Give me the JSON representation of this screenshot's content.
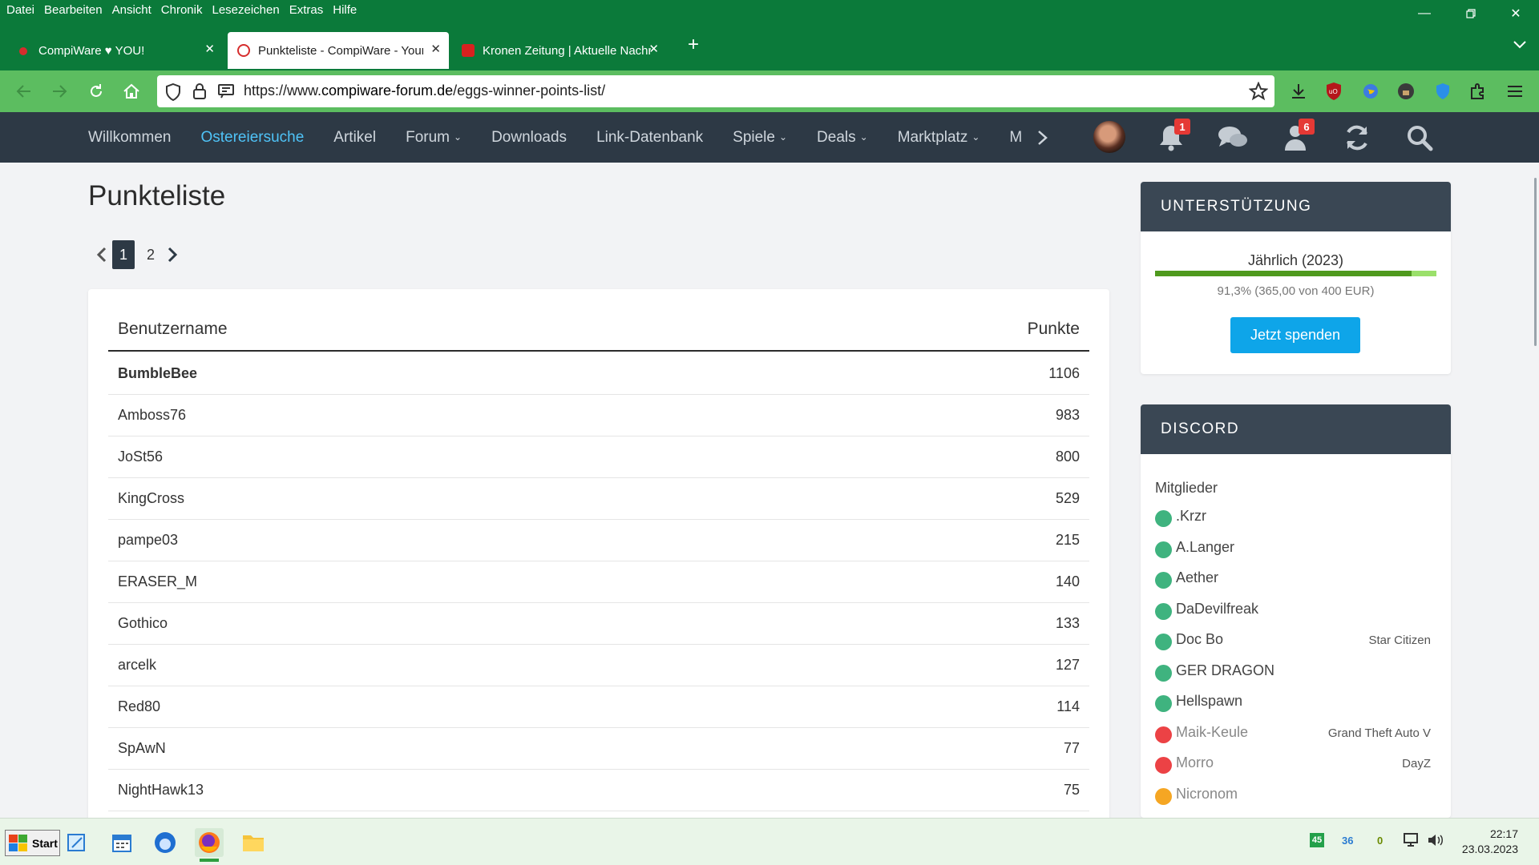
{
  "browser": {
    "menu": [
      "Datei",
      "Bearbeiten",
      "Ansicht",
      "Chronik",
      "Lesezeichen",
      "Extras",
      "Hilfe"
    ],
    "tabs": [
      {
        "title": "CompiWare ♥ YOU!",
        "active": false
      },
      {
        "title": "Punkteliste - CompiWare - Your",
        "active": true
      },
      {
        "title": "Kronen Zeitung | Aktuelle Nachr",
        "active": false
      }
    ],
    "url_prefix": "https://www.",
    "url_domain": "compiware-forum.de",
    "url_path": "/eggs-winner-points-list/"
  },
  "site": {
    "nav": [
      {
        "label": "Willkommen",
        "active": false,
        "dropdown": false
      },
      {
        "label": "Ostereiersuche",
        "active": true,
        "dropdown": false
      },
      {
        "label": "Artikel",
        "active": false,
        "dropdown": false
      },
      {
        "label": "Forum",
        "active": false,
        "dropdown": true
      },
      {
        "label": "Downloads",
        "active": false,
        "dropdown": false
      },
      {
        "label": "Link-Datenbank",
        "active": false,
        "dropdown": false
      },
      {
        "label": "Spiele",
        "active": false,
        "dropdown": true
      },
      {
        "label": "Deals",
        "active": false,
        "dropdown": true
      },
      {
        "label": "Marktplatz",
        "active": false,
        "dropdown": true
      },
      {
        "label": "M",
        "active": false,
        "dropdown": false
      }
    ],
    "notifications_badge": "1",
    "users_badge": "6",
    "accent": "#4fc3f7",
    "header_bg": "#2d3945"
  },
  "main": {
    "title": "Punkteliste",
    "pages": [
      "1",
      "2"
    ],
    "current_page": "1",
    "col_user": "Benutzername",
    "col_points": "Punkte",
    "rows": [
      {
        "name": "BumbleBee",
        "points": "1106"
      },
      {
        "name": "Amboss76",
        "points": "983"
      },
      {
        "name": "JoSt56",
        "points": "800"
      },
      {
        "name": "KingCross",
        "points": "529"
      },
      {
        "name": "pampe03",
        "points": "215"
      },
      {
        "name": "ERASER_M",
        "points": "140"
      },
      {
        "name": "Gothico",
        "points": "133"
      },
      {
        "name": "arcelk",
        "points": "127"
      },
      {
        "name": "Red80",
        "points": "114"
      },
      {
        "name": "SpAwN",
        "points": "77"
      },
      {
        "name": "NightHawk13",
        "points": "75"
      }
    ]
  },
  "sidebar": {
    "support": {
      "title": "UNTERSTÜTZUNG",
      "label": "Jährlich (2023)",
      "progress": 0.913,
      "sub": "91,3% (365,00 von 400 EUR)",
      "button": "Jetzt spenden"
    },
    "discord": {
      "title": "DISCORD",
      "members_label": "Mitglieder",
      "members": [
        {
          "name": ".Krzr",
          "status": "#3fb37f",
          "game": "",
          "dim": false
        },
        {
          "name": "A.Langer",
          "status": "#3fb37f",
          "game": "",
          "dim": false
        },
        {
          "name": "Aether",
          "status": "#3fb37f",
          "game": "",
          "dim": false
        },
        {
          "name": "DaDevilfreak",
          "status": "#3fb37f",
          "game": "",
          "dim": false
        },
        {
          "name": "Doc Bo",
          "status": "#3fb37f",
          "game": "Star Citizen",
          "dim": false
        },
        {
          "name": "GER DRAGON",
          "status": "#3fb37f",
          "game": "",
          "dim": false
        },
        {
          "name": "Hellspawn",
          "status": "#3fb37f",
          "game": "",
          "dim": false
        },
        {
          "name": "Maik-Keule",
          "status": "#ec4245",
          "game": "Grand Theft Auto V",
          "dim": true
        },
        {
          "name": "Morro",
          "status": "#ec4245",
          "game": "DayZ",
          "dim": true
        },
        {
          "name": "Nicronom",
          "status": "#f5a623",
          "game": "",
          "dim": true
        }
      ]
    }
  },
  "taskbar": {
    "start": "Start",
    "tray": [
      "45",
      "36",
      "0"
    ],
    "time": "22:17",
    "date": "23.03.2023"
  }
}
